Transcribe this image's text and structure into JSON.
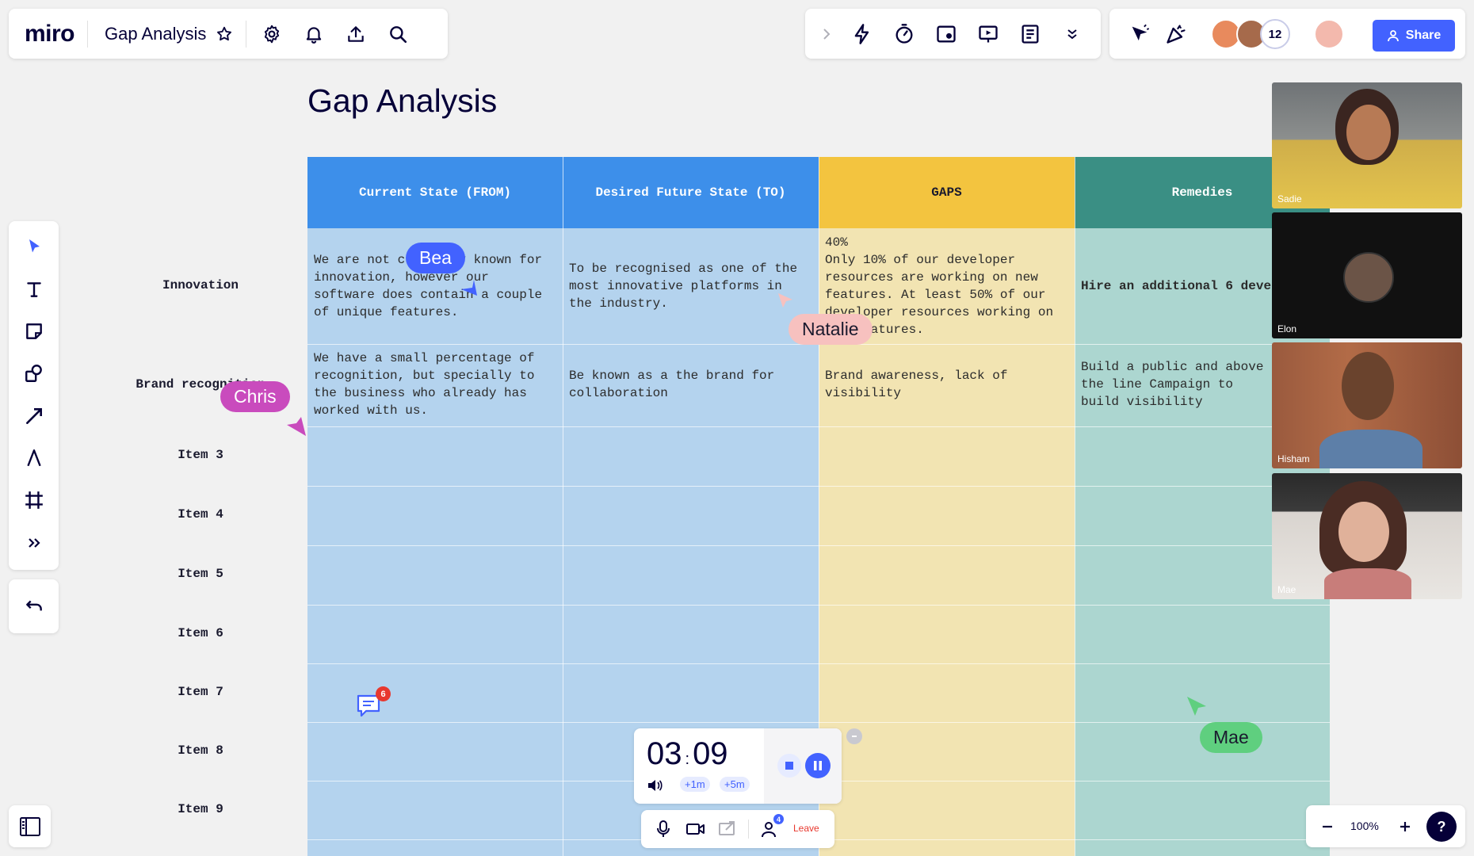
{
  "app": {
    "logo": "miro",
    "board_title": "Gap Analysis"
  },
  "collab": {
    "share_label": "Share",
    "participant_count": "12"
  },
  "page_title": "Gap Analysis",
  "columns": [
    {
      "label": "Current State (FROM)",
      "bg": "#3d8fea",
      "body_bg": "#b4d3ee",
      "text": "#ffffff"
    },
    {
      "label": "Desired Future State (TO)",
      "bg": "#3d8fea",
      "body_bg": "#b4d3ee",
      "text": "#ffffff"
    },
    {
      "label": "GAPS",
      "bg": "#f3c43f",
      "body_bg": "#f2e4b2",
      "text": "#1a1a2e"
    },
    {
      "label": "Remedies",
      "bg": "#3a8f84",
      "body_bg": "#acd6d0",
      "text": "#ffffff"
    }
  ],
  "rows": [
    {
      "label": "Innovation",
      "cells": [
        "We are not currently known for innovation, however our software does contain a couple of unique features.",
        "To be recognised as one of the most innovative platforms in the industry.",
        "40%\nOnly 10% of our developer resources are working on new features. At least 50% of our developer resources working on new features.",
        "Hire an additional 6 developers"
      ]
    },
    {
      "label": "Brand recognition",
      "cells": [
        "We have a small percentage of recognition, but specially to the business who already has worked with us.",
        "Be known as a the brand for collaboration",
        "Brand awareness, lack of visibility",
        "Build a public and above the line Campaign to build visibility"
      ]
    },
    {
      "label": "Item 3"
    },
    {
      "label": "Item 4"
    },
    {
      "label": "Item 5"
    },
    {
      "label": "Item 6"
    },
    {
      "label": "Item 7"
    },
    {
      "label": "Item 8"
    },
    {
      "label": "Item 9"
    }
  ],
  "cursors": [
    {
      "name": "Bea",
      "color": "#4262ff"
    },
    {
      "name": "Chris",
      "color": "#c94bbd"
    },
    {
      "name": "Natalie",
      "color": "#f7c1bf"
    },
    {
      "name": "Mae",
      "color": "#5fcf7f"
    }
  ],
  "comments": {
    "count": "6"
  },
  "videos": [
    {
      "name": "Sadie"
    },
    {
      "name": "Elon"
    },
    {
      "name": "Hisham"
    },
    {
      "name": "Mae"
    }
  ],
  "timer": {
    "minutes": "03",
    "seconds": "09",
    "add1": "+1m",
    "add5": "+5m"
  },
  "call": {
    "leave_label": "Leave",
    "participants_badge": "4"
  },
  "zoom": {
    "level": "100%"
  }
}
